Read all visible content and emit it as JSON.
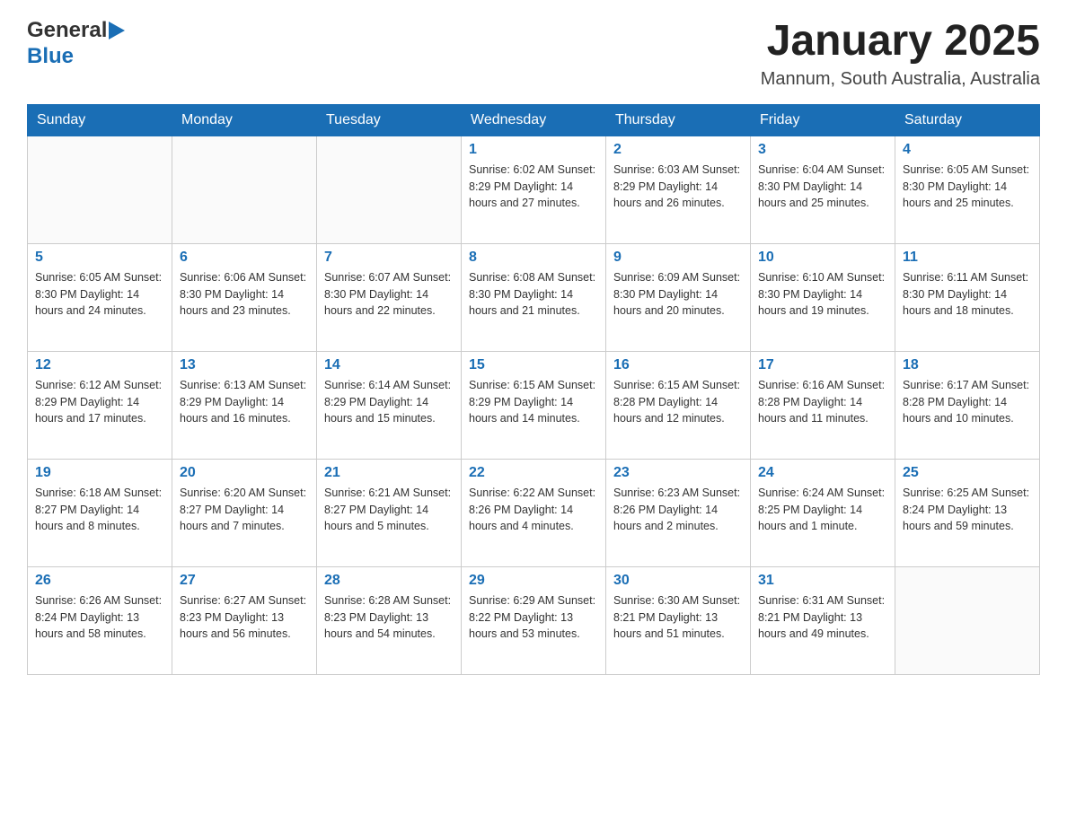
{
  "header": {
    "logo_general": "General",
    "logo_blue": "Blue",
    "month_title": "January 2025",
    "location": "Mannum, South Australia, Australia"
  },
  "days_of_week": [
    "Sunday",
    "Monday",
    "Tuesday",
    "Wednesday",
    "Thursday",
    "Friday",
    "Saturday"
  ],
  "weeks": [
    [
      {
        "day": "",
        "info": ""
      },
      {
        "day": "",
        "info": ""
      },
      {
        "day": "",
        "info": ""
      },
      {
        "day": "1",
        "info": "Sunrise: 6:02 AM\nSunset: 8:29 PM\nDaylight: 14 hours\nand 27 minutes."
      },
      {
        "day": "2",
        "info": "Sunrise: 6:03 AM\nSunset: 8:29 PM\nDaylight: 14 hours\nand 26 minutes."
      },
      {
        "day": "3",
        "info": "Sunrise: 6:04 AM\nSunset: 8:30 PM\nDaylight: 14 hours\nand 25 minutes."
      },
      {
        "day": "4",
        "info": "Sunrise: 6:05 AM\nSunset: 8:30 PM\nDaylight: 14 hours\nand 25 minutes."
      }
    ],
    [
      {
        "day": "5",
        "info": "Sunrise: 6:05 AM\nSunset: 8:30 PM\nDaylight: 14 hours\nand 24 minutes."
      },
      {
        "day": "6",
        "info": "Sunrise: 6:06 AM\nSunset: 8:30 PM\nDaylight: 14 hours\nand 23 minutes."
      },
      {
        "day": "7",
        "info": "Sunrise: 6:07 AM\nSunset: 8:30 PM\nDaylight: 14 hours\nand 22 minutes."
      },
      {
        "day": "8",
        "info": "Sunrise: 6:08 AM\nSunset: 8:30 PM\nDaylight: 14 hours\nand 21 minutes."
      },
      {
        "day": "9",
        "info": "Sunrise: 6:09 AM\nSunset: 8:30 PM\nDaylight: 14 hours\nand 20 minutes."
      },
      {
        "day": "10",
        "info": "Sunrise: 6:10 AM\nSunset: 8:30 PM\nDaylight: 14 hours\nand 19 minutes."
      },
      {
        "day": "11",
        "info": "Sunrise: 6:11 AM\nSunset: 8:30 PM\nDaylight: 14 hours\nand 18 minutes."
      }
    ],
    [
      {
        "day": "12",
        "info": "Sunrise: 6:12 AM\nSunset: 8:29 PM\nDaylight: 14 hours\nand 17 minutes."
      },
      {
        "day": "13",
        "info": "Sunrise: 6:13 AM\nSunset: 8:29 PM\nDaylight: 14 hours\nand 16 minutes."
      },
      {
        "day": "14",
        "info": "Sunrise: 6:14 AM\nSunset: 8:29 PM\nDaylight: 14 hours\nand 15 minutes."
      },
      {
        "day": "15",
        "info": "Sunrise: 6:15 AM\nSunset: 8:29 PM\nDaylight: 14 hours\nand 14 minutes."
      },
      {
        "day": "16",
        "info": "Sunrise: 6:15 AM\nSunset: 8:28 PM\nDaylight: 14 hours\nand 12 minutes."
      },
      {
        "day": "17",
        "info": "Sunrise: 6:16 AM\nSunset: 8:28 PM\nDaylight: 14 hours\nand 11 minutes."
      },
      {
        "day": "18",
        "info": "Sunrise: 6:17 AM\nSunset: 8:28 PM\nDaylight: 14 hours\nand 10 minutes."
      }
    ],
    [
      {
        "day": "19",
        "info": "Sunrise: 6:18 AM\nSunset: 8:27 PM\nDaylight: 14 hours\nand 8 minutes."
      },
      {
        "day": "20",
        "info": "Sunrise: 6:20 AM\nSunset: 8:27 PM\nDaylight: 14 hours\nand 7 minutes."
      },
      {
        "day": "21",
        "info": "Sunrise: 6:21 AM\nSunset: 8:27 PM\nDaylight: 14 hours\nand 5 minutes."
      },
      {
        "day": "22",
        "info": "Sunrise: 6:22 AM\nSunset: 8:26 PM\nDaylight: 14 hours\nand 4 minutes."
      },
      {
        "day": "23",
        "info": "Sunrise: 6:23 AM\nSunset: 8:26 PM\nDaylight: 14 hours\nand 2 minutes."
      },
      {
        "day": "24",
        "info": "Sunrise: 6:24 AM\nSunset: 8:25 PM\nDaylight: 14 hours\nand 1 minute."
      },
      {
        "day": "25",
        "info": "Sunrise: 6:25 AM\nSunset: 8:24 PM\nDaylight: 13 hours\nand 59 minutes."
      }
    ],
    [
      {
        "day": "26",
        "info": "Sunrise: 6:26 AM\nSunset: 8:24 PM\nDaylight: 13 hours\nand 58 minutes."
      },
      {
        "day": "27",
        "info": "Sunrise: 6:27 AM\nSunset: 8:23 PM\nDaylight: 13 hours\nand 56 minutes."
      },
      {
        "day": "28",
        "info": "Sunrise: 6:28 AM\nSunset: 8:23 PM\nDaylight: 13 hours\nand 54 minutes."
      },
      {
        "day": "29",
        "info": "Sunrise: 6:29 AM\nSunset: 8:22 PM\nDaylight: 13 hours\nand 53 minutes."
      },
      {
        "day": "30",
        "info": "Sunrise: 6:30 AM\nSunset: 8:21 PM\nDaylight: 13 hours\nand 51 minutes."
      },
      {
        "day": "31",
        "info": "Sunrise: 6:31 AM\nSunset: 8:21 PM\nDaylight: 13 hours\nand 49 minutes."
      },
      {
        "day": "",
        "info": ""
      }
    ]
  ]
}
